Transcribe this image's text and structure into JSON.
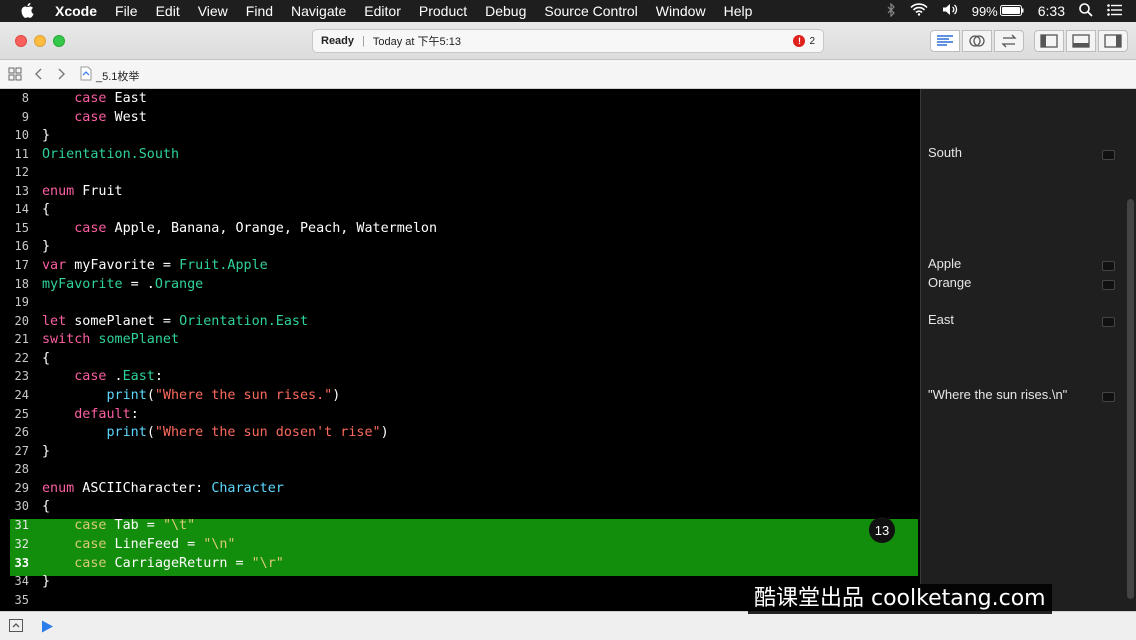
{
  "menubar": {
    "app": "Xcode",
    "items": [
      "File",
      "Edit",
      "View",
      "Find",
      "Navigate",
      "Editor",
      "Product",
      "Debug",
      "Source Control",
      "Window",
      "Help"
    ],
    "battery": "99%",
    "time": "6:33"
  },
  "toolbar": {
    "status": "Ready",
    "timestamp": "Today at 下午5:13",
    "error_count": "2"
  },
  "jumpbar": {
    "file": "_5.1枚举"
  },
  "editor": {
    "highlight_badge": "13",
    "lines": [
      {
        "n": "8"
      },
      {
        "n": "9"
      },
      {
        "n": "10"
      },
      {
        "n": "11"
      },
      {
        "n": "12"
      },
      {
        "n": "13"
      },
      {
        "n": "14"
      },
      {
        "n": "15"
      },
      {
        "n": "16"
      },
      {
        "n": "17"
      },
      {
        "n": "18"
      },
      {
        "n": "19"
      },
      {
        "n": "20"
      },
      {
        "n": "21"
      },
      {
        "n": "22"
      },
      {
        "n": "23"
      },
      {
        "n": "24"
      },
      {
        "n": "25"
      },
      {
        "n": "26"
      },
      {
        "n": "27"
      },
      {
        "n": "28"
      },
      {
        "n": "29"
      },
      {
        "n": "30"
      },
      {
        "n": "31"
      },
      {
        "n": "32"
      },
      {
        "n": "33"
      },
      {
        "n": "34"
      },
      {
        "n": "35"
      }
    ],
    "tokens": {
      "l8a": "case",
      "l8b": " East",
      "l9a": "case",
      "l9b": " West",
      "l10": "}",
      "l11": "Orientation.South",
      "l13a": "enum",
      "l13b": " Fruit",
      "l14": "{",
      "l15a": "case",
      "l15b": " Apple, Banana, Orange, Peach, Watermelon",
      "l16": "}",
      "l17a": "var",
      "l17b": " myFavorite = ",
      "l17c": "Fruit.Apple",
      "l18a": "myFavorite",
      "l18b": " = .",
      "l18c": "Orange",
      "l20a": "let",
      "l20b": " somePlanet = ",
      "l20c": "Orientation.East",
      "l21a": "switch",
      "l21b": " somePlanet",
      "l22": "{",
      "l23a": "case",
      "l23b": " .",
      "l23c": "East",
      "l23d": ":",
      "l24a": "print",
      "l24b": "(",
      "l24c": "\"Where the sun rises.\"",
      "l24d": ")",
      "l25a": "default",
      "l25b": ":",
      "l26a": "print",
      "l26b": "(",
      "l26c": "\"Where the sun dosen't rise\"",
      "l26d": ")",
      "l27": "}",
      "l29a": "enum",
      "l29b": " ASCIICharacter: ",
      "l29c": "Character",
      "l30": "{",
      "l31a": "case",
      "l31b": " Tab = ",
      "l31c": "\"\\t\"",
      "l32a": "case",
      "l32b": " LineFeed = ",
      "l32c": "\"\\n\"",
      "l33a": "case",
      "l33b": " CarriageReturn = ",
      "l33c": "\"\\r\"",
      "l34": "}"
    }
  },
  "results": [
    {
      "text": "South"
    },
    {
      "text": "Apple"
    },
    {
      "text": "Orange"
    },
    {
      "text": "East"
    },
    {
      "text": "\"Where the sun rises.\\n\""
    }
  ],
  "watermark": "酷课堂出品 coolketang.com",
  "colors": {
    "keyword": "#fc5fa3",
    "type": "#2fd39a",
    "string": "#fc6a5d",
    "function": "#5dd8ff",
    "highlight": "#138e0c"
  }
}
